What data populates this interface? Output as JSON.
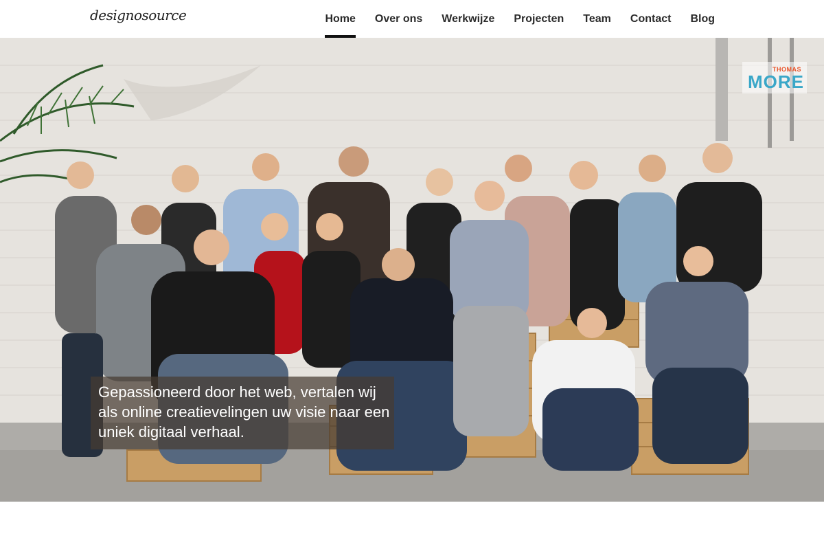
{
  "header": {
    "logo_text": "designosource",
    "nav": [
      {
        "label": "Home",
        "active": true
      },
      {
        "label": "Over ons",
        "active": false
      },
      {
        "label": "Werkwijze",
        "active": false
      },
      {
        "label": "Projecten",
        "active": false
      },
      {
        "label": "Team",
        "active": false
      },
      {
        "label": "Contact",
        "active": false
      },
      {
        "label": "Blog",
        "active": false
      }
    ]
  },
  "hero": {
    "partner_logo": {
      "small": "THOMAS",
      "big": "MORE"
    },
    "tagline": "Gepassioneerd door het web, vertalen wij als online creatievelingen uw visie naar een uniek digitaal verhaal."
  },
  "colors": {
    "nav_active_underline": "#111111",
    "tagline_bg": "#463c32",
    "wall": "#e9e6e1",
    "floor": "#a9a7a3",
    "pallet_wood": "#c9a06a"
  }
}
